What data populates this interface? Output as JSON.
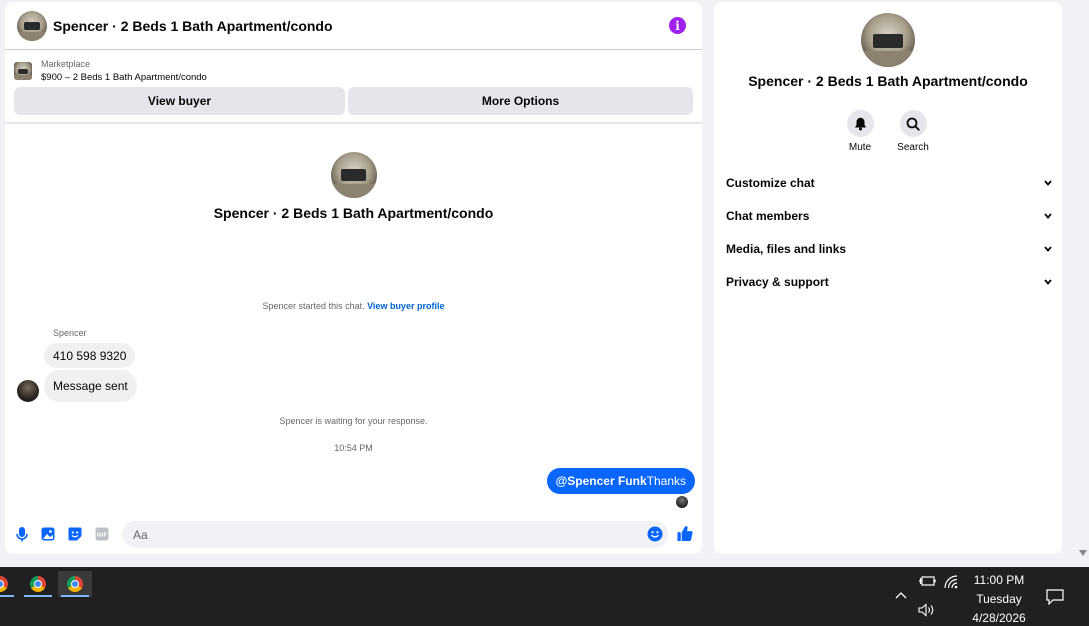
{
  "chat": {
    "header_title": "Spencer · 2 Beds 1 Bath Apartment/condo",
    "info_glyph": "i",
    "marketplace_label": "Marketplace",
    "listing_price_title": "$900 – 2 Beds 1 Bath Apartment/condo",
    "view_buyer_label": "View buyer",
    "more_options_label": "More Options",
    "intro_title": "Spencer · 2 Beds 1 Bath Apartment/condo",
    "started_text": "Spencer started this chat. ",
    "view_buyer_profile_link": "View buyer profile",
    "sender_name": "Spencer",
    "incoming_messages": [
      "410 598 9320",
      "Message sent"
    ],
    "waiting_text": "Spencer is waiting for your response.",
    "timestamp": "10:54 PM",
    "outgoing_mention": "@Spencer Funk",
    "outgoing_text": "Thanks",
    "composer_placeholder": "Aa",
    "accent_color": "#0866ff"
  },
  "info_panel": {
    "title": "Spencer · 2 Beds 1 Bath Apartment/condo",
    "actions": [
      {
        "label": "Mute",
        "icon": "bell-icon"
      },
      {
        "label": "Search",
        "icon": "search-icon"
      }
    ],
    "sections": [
      "Customize chat",
      "Chat members",
      "Media, files and links",
      "Privacy & support"
    ]
  },
  "taskbar": {
    "time": "11:00 PM",
    "day": "Tuesday",
    "date": "4/28/2026"
  }
}
